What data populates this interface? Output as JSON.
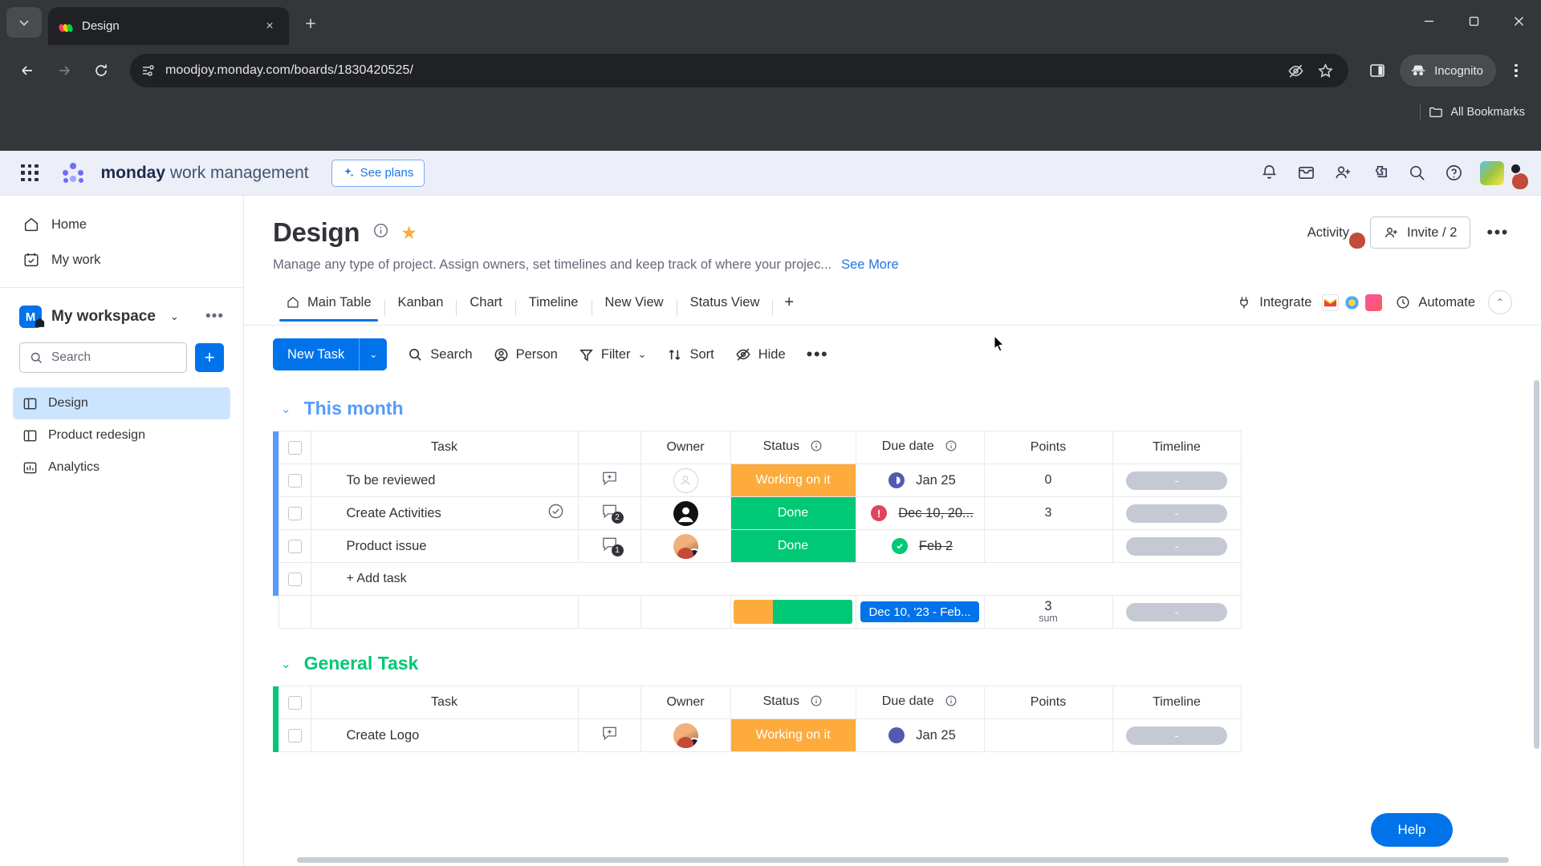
{
  "browser": {
    "tab": {
      "title": "Design",
      "close_label": "×"
    },
    "newtab_label": "+",
    "url": "moodjoy.monday.com/boards/1830420525/",
    "profile_label": "Incognito",
    "bookmarks_label": "All Bookmarks",
    "window": {
      "minimize": "—",
      "maximize": "▢",
      "close": "✕"
    }
  },
  "monday_header": {
    "brand_bold": "monday",
    "brand_light": " work management",
    "see_plans": "See plans",
    "icons": [
      "notifications-icon",
      "inbox-icon",
      "invite-icon",
      "apps-icon",
      "search-icon",
      "help-icon"
    ]
  },
  "sidebar": {
    "nav": [
      {
        "label": "Home",
        "icon": "home-icon"
      },
      {
        "label": "My work",
        "icon": "my-work-icon"
      }
    ],
    "workspace": {
      "initial": "M",
      "name": "My workspace"
    },
    "search_placeholder": "Search",
    "add_label": "+",
    "boards": [
      {
        "label": "Design",
        "icon": "board-icon",
        "active": true
      },
      {
        "label": "Product redesign",
        "icon": "board-icon",
        "active": false
      },
      {
        "label": "Analytics",
        "icon": "dashboard-icon",
        "active": false
      }
    ]
  },
  "board": {
    "title": "Design",
    "description": "Manage any type of project. Assign owners, set timelines and keep track of where your projec...",
    "see_more": "See More",
    "activity_label": "Activity",
    "invite_label": "Invite / 2",
    "views": [
      {
        "label": "Main Table",
        "active": true,
        "icon": "home-icon"
      },
      {
        "label": "Kanban",
        "active": false
      },
      {
        "label": "Chart",
        "active": false
      },
      {
        "label": "Timeline",
        "active": false
      },
      {
        "label": "New View",
        "active": false
      },
      {
        "label": "Status View",
        "active": false
      }
    ],
    "add_view_label": "+",
    "integrate_label": "Integrate",
    "automate_label": "Automate",
    "toolbar": {
      "new_task": "New Task",
      "new_task_caret": "⌄",
      "search": "Search",
      "person": "Person",
      "filter": "Filter",
      "filter_caret": "⌄",
      "sort": "Sort",
      "hide": "Hide",
      "more": "•••"
    }
  },
  "table": {
    "columns": [
      "Task",
      "Owner",
      "Status",
      "Due date",
      "Points",
      "Timeline"
    ],
    "groups": [
      {
        "name": "This month",
        "color": "blue",
        "rows": [
          {
            "task": "To be reviewed",
            "owner": "none",
            "status": "Working on it",
            "status_color": "orange",
            "due": "Jan 25",
            "due_strike": false,
            "due_icon": "clock-icon",
            "points": "0",
            "timeline": "-",
            "comment_icon": "add-comment-icon",
            "comment_count": "",
            "check_icon": ""
          },
          {
            "task": "Create Activities",
            "owner": "dark",
            "status": "Done",
            "status_color": "green",
            "due": "Dec 10, 20...",
            "due_strike": true,
            "due_icon": "alert-icon",
            "points": "3",
            "timeline": "-",
            "comment_icon": "comment-icon",
            "comment_count": "2",
            "check_icon": "check-circle-icon"
          },
          {
            "task": "Product issue",
            "owner": "photo",
            "status": "Done",
            "status_color": "green",
            "due": "Feb 2",
            "due_strike": true,
            "due_icon": "check-icon",
            "points": "",
            "timeline": "-",
            "comment_icon": "comment-icon",
            "comment_count": "1",
            "check_icon": ""
          }
        ],
        "add_task_label": "+ Add task",
        "summary": {
          "date": "Dec 10, '23 - Feb...",
          "points": "3",
          "points_label": "sum",
          "timeline": "-"
        }
      },
      {
        "name": "General Task",
        "color": "green",
        "rows": [
          {
            "task": "Create Logo",
            "owner": "photo",
            "status": "Working on it",
            "status_color": "orange",
            "due": "Jan 25",
            "due_strike": false,
            "due_icon": "clock-icon",
            "points": "",
            "timeline": "-",
            "comment_icon": "add-comment-icon",
            "comment_count": "",
            "check_icon": ""
          }
        ]
      }
    ]
  },
  "help": {
    "label": "Help"
  },
  "colors": {
    "accent": "#0073ea",
    "status_orange": "#fdab3d",
    "status_green": "#00c875",
    "group_blue": "#579bfc",
    "group_green": "#00c875",
    "star_yellow": "#fdab3d"
  }
}
